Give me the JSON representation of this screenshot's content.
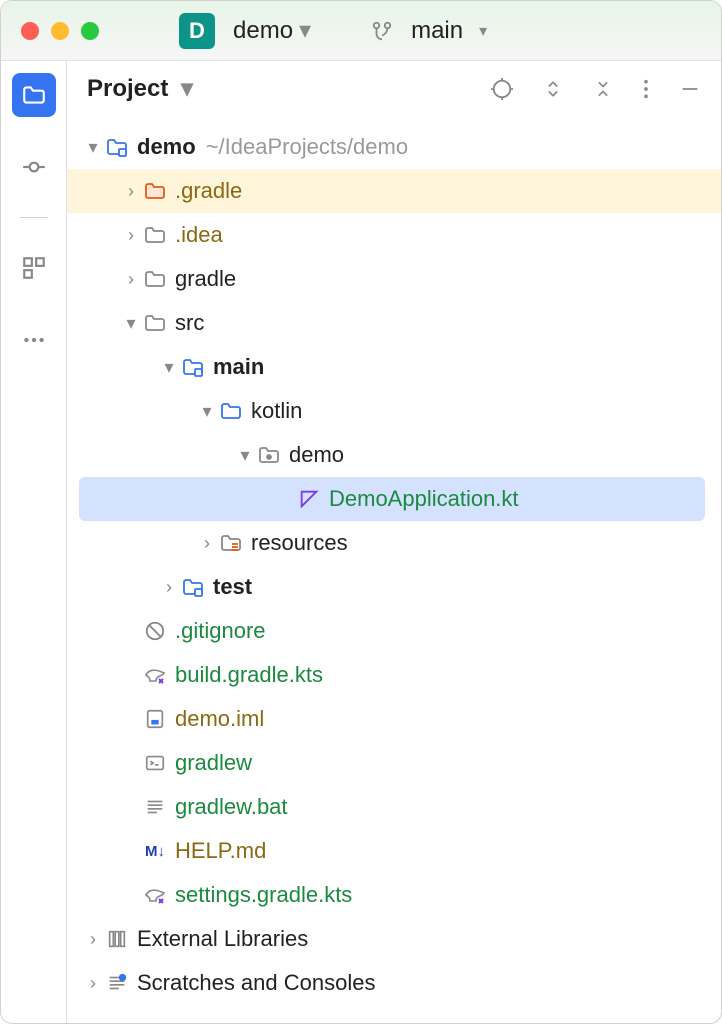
{
  "titlebar": {
    "project_badge": "D",
    "project_name": "demo",
    "branch": "main"
  },
  "panel": {
    "title": "Project"
  },
  "tree": {
    "root": {
      "name": "demo",
      "path": "~/IdeaProjects/demo"
    },
    "gradle_hidden": ".gradle",
    "idea": ".idea",
    "gradle": "gradle",
    "src": "src",
    "main": "main",
    "kotlin": "kotlin",
    "demo_pkg": "demo",
    "demo_app": "DemoApplication.kt",
    "resources": "resources",
    "test": "test",
    "gitignore": ".gitignore",
    "build_gradle": "build.gradle.kts",
    "demo_iml": "demo.iml",
    "gradlew": "gradlew",
    "gradlew_bat": "gradlew.bat",
    "help_md": "HELP.md",
    "settings_gradle": "settings.gradle.kts",
    "external_libs": "External Libraries",
    "scratches": "Scratches and Consoles"
  }
}
